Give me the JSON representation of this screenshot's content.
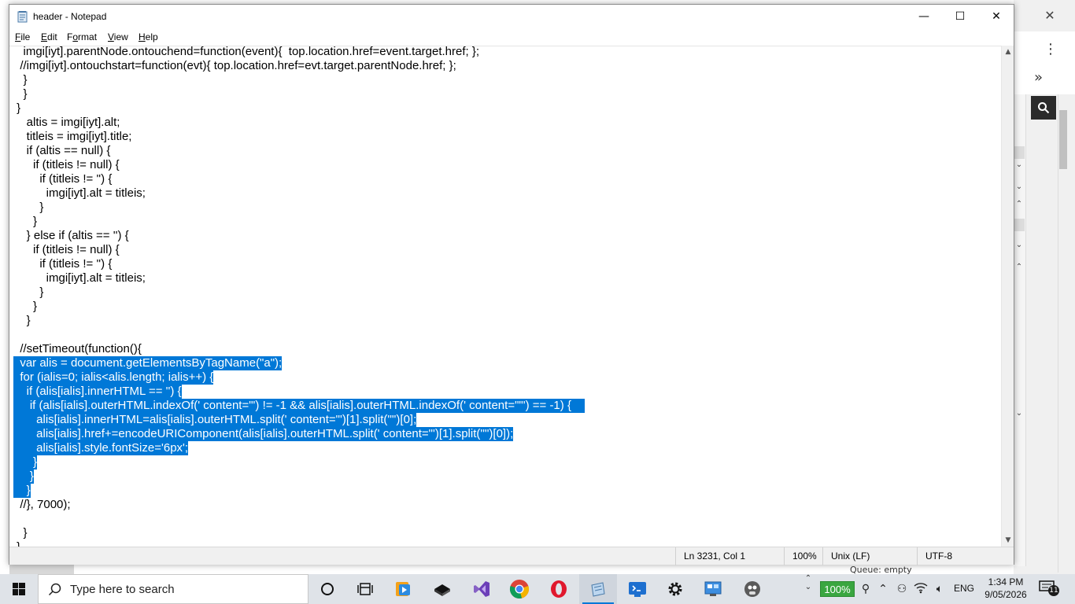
{
  "window": {
    "title": "header - Notepad",
    "min_glyph": "—",
    "max_glyph": "☐",
    "close_glyph": "✕"
  },
  "menu": {
    "items": [
      {
        "underline": "F",
        "rest": "ile"
      },
      {
        "underline": "E",
        "rest": "dit"
      },
      {
        "pre": "F",
        "underline": "o",
        "rest": "rmat"
      },
      {
        "underline": "V",
        "rest": "iew"
      },
      {
        "underline": "H",
        "rest": "elp"
      }
    ]
  },
  "editor": {
    "selection_color": "#0078d7",
    "lines": [
      {
        "text": "   imgi[iyt].parentNode.ontouchend=function(event){  top.location.href=event.target.href; };",
        "sel": false
      },
      {
        "text": "  //imgi[iyt].ontouchstart=function(evt){ top.location.href=evt.target.parentNode.href; };",
        "sel": false
      },
      {
        "text": "   }",
        "sel": false
      },
      {
        "text": "   }",
        "sel": false
      },
      {
        "text": " }",
        "sel": false
      },
      {
        "text": "    altis = imgi[iyt].alt;",
        "sel": false
      },
      {
        "text": "    titleis = imgi[iyt].title;",
        "sel": false
      },
      {
        "text": "    if (altis == null) {",
        "sel": false
      },
      {
        "text": "      if (titleis != null) {",
        "sel": false
      },
      {
        "text": "        if (titleis != '') {",
        "sel": false
      },
      {
        "text": "          imgi[iyt].alt = titleis;",
        "sel": false
      },
      {
        "text": "        }",
        "sel": false
      },
      {
        "text": "      }",
        "sel": false
      },
      {
        "text": "    } else if (altis == '') {",
        "sel": false
      },
      {
        "text": "      if (titleis != null) {",
        "sel": false
      },
      {
        "text": "        if (titleis != '') {",
        "sel": false
      },
      {
        "text": "          imgi[iyt].alt = titleis;",
        "sel": false
      },
      {
        "text": "        }",
        "sel": false
      },
      {
        "text": "      }",
        "sel": false
      },
      {
        "text": "    }",
        "sel": false
      },
      {
        "text": "",
        "sel": false
      },
      {
        "text": "  //setTimeout(function(){",
        "sel": false
      },
      {
        "text": "  var alis = document.getElementsByTagName(\"a\");",
        "sel": true
      },
      {
        "text": "  for (ialis=0; ialis<alis.length; ialis++) {",
        "sel": true
      },
      {
        "text": "    if (alis[ialis].innerHTML == '') {",
        "sel": true
      },
      {
        "text": "     if (alis[ialis].outerHTML.indexOf(' content=\"') != -1 && alis[ialis].outerHTML.indexOf(' content=\"\"') == -1) {    ",
        "sel": true
      },
      {
        "text": "       alis[ialis].innerHTML=alis[ialis].outerHTML.split(' content=\"')[1].split('\"')[0];",
        "sel": true
      },
      {
        "text": "       alis[ialis].href+=encodeURIComponent(alis[ialis].outerHTML.split(' content=\"')[1].split('\"')[0]);",
        "sel": true
      },
      {
        "text": "       alis[ialis].style.fontSize='6px';",
        "sel": true
      },
      {
        "text": "      }",
        "sel": true
      },
      {
        "text": "     }",
        "sel": true
      },
      {
        "text": "    }",
        "sel": true
      },
      {
        "text": "  //}, 7000);",
        "sel": false
      },
      {
        "text": "",
        "sel": false
      },
      {
        "text": "   }",
        "sel": false
      },
      {
        "text": " }",
        "sel": false
      }
    ]
  },
  "statusbar": {
    "position": "Ln 3231, Col 1",
    "zoom": "100%",
    "line_ending": "Unix (LF)",
    "encoding": "UTF-8"
  },
  "background": {
    "queue_text": "Queue: empty"
  },
  "taskbar": {
    "search_placeholder": "Type here to search",
    "apps": [
      {
        "name": "task-view-icon"
      },
      {
        "name": "widgets-icon"
      },
      {
        "name": "media-player-icon"
      },
      {
        "name": "virtualbox-icon"
      },
      {
        "name": "visual-studio-icon"
      },
      {
        "name": "chrome-icon"
      },
      {
        "name": "opera-icon"
      },
      {
        "name": "notepad-taskbar-icon"
      },
      {
        "name": "terminal-icon"
      },
      {
        "name": "settings-icon"
      },
      {
        "name": "control-panel-icon"
      },
      {
        "name": "gimp-icon"
      }
    ],
    "battery": "100%",
    "language": "ENG",
    "time": "1:34 PM",
    "date": "9/05/2026",
    "notification_count": "11"
  }
}
